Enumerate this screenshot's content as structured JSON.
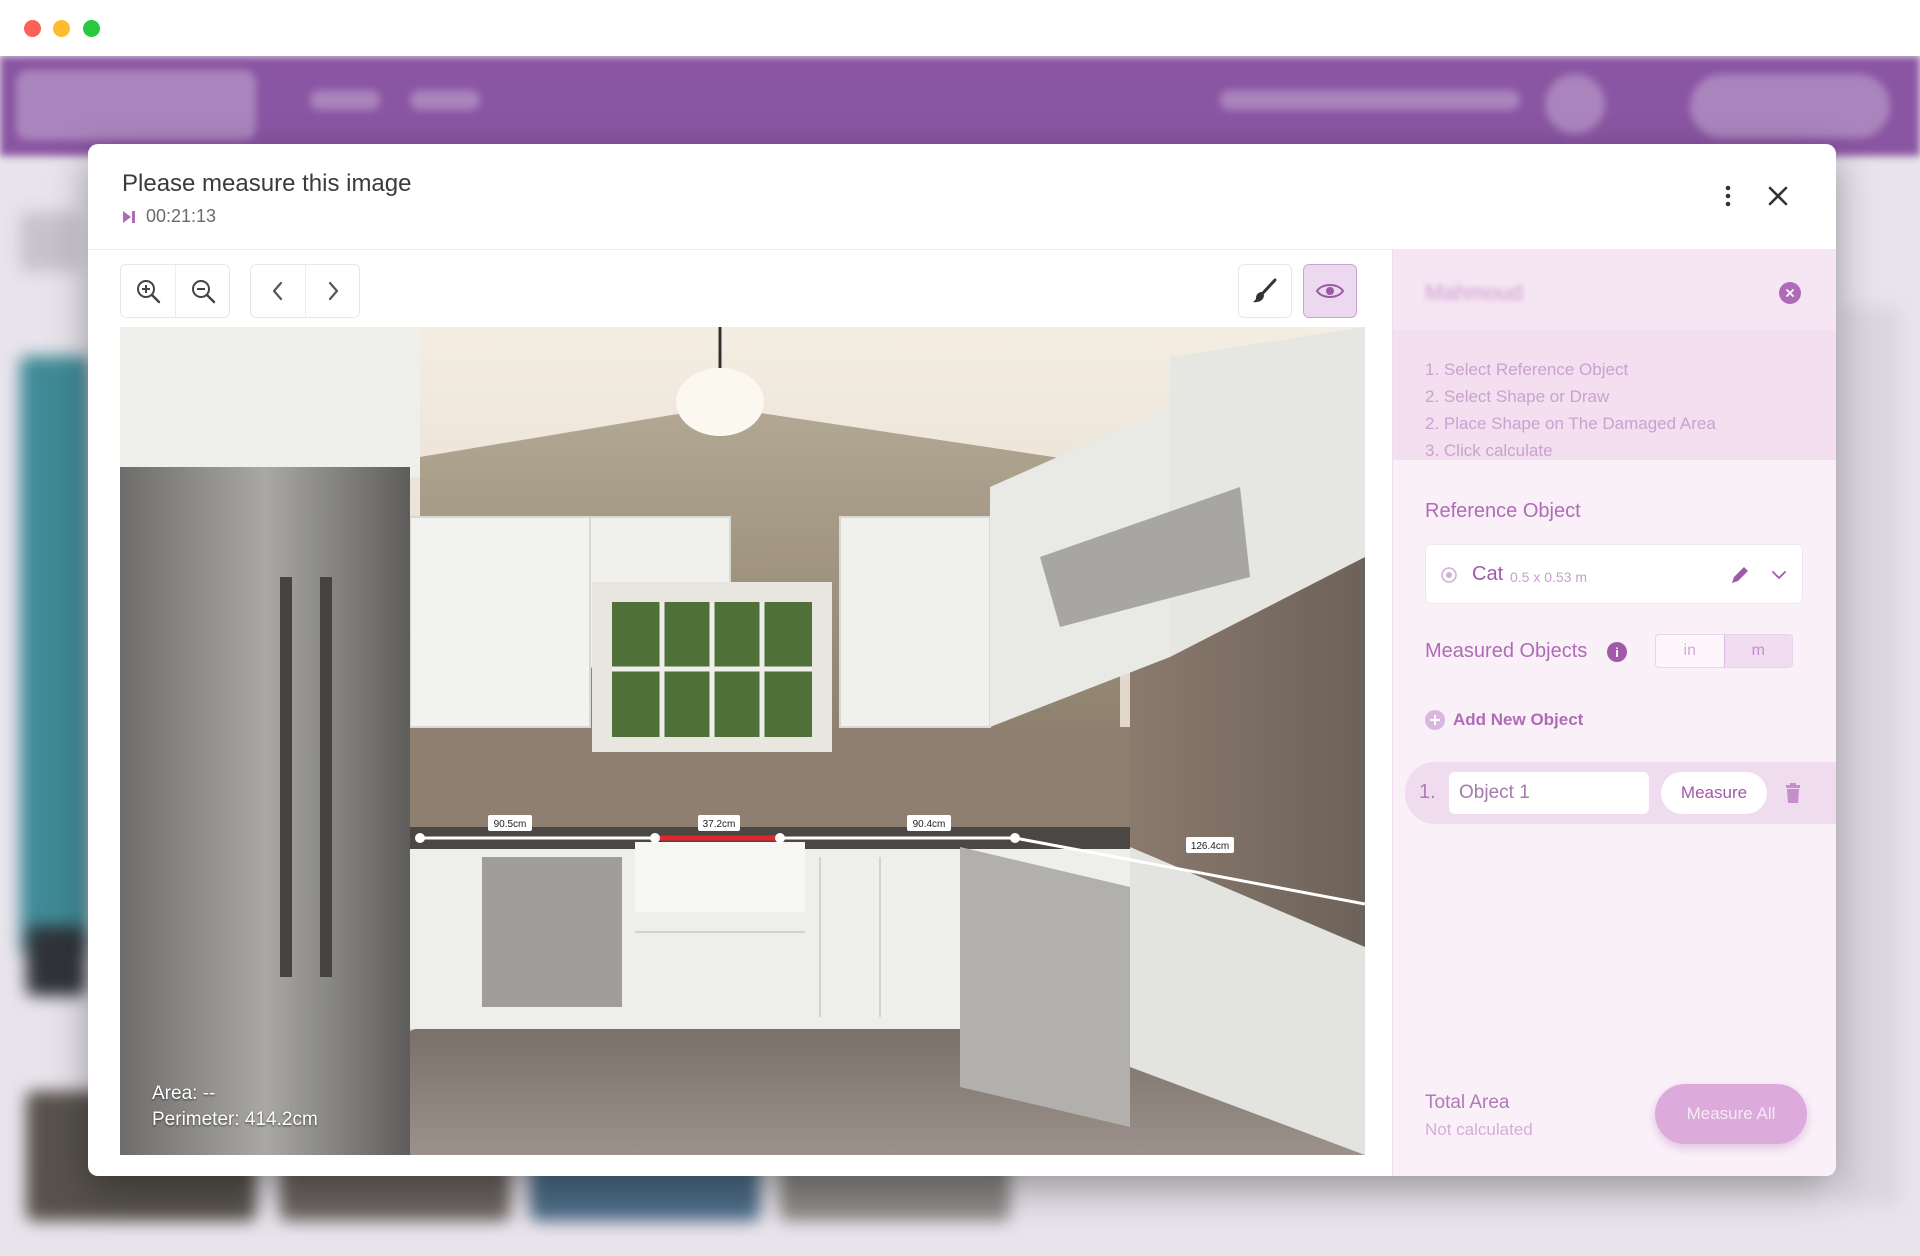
{
  "modal": {
    "title": "Please measure this image",
    "timer": "00:21:13"
  },
  "canvas": {
    "area_text": "Area: --",
    "perimeter_text": "Perimeter: 414.2cm",
    "measurement_labels": [
      "90.5cm",
      "37.2cm",
      "90.4cm",
      "126.4cm"
    ]
  },
  "panel": {
    "title": "Mahmoud",
    "steps": [
      "1. Select Reference Object",
      "2. Select Shape or Draw",
      "2. Place Shape on The Damaged Area",
      "3. Click calculate"
    ],
    "reference_label": "Reference Object",
    "reference_name": "Cat",
    "reference_dims": "0.5 x 0.53 m",
    "measured_label": "Measured Objects",
    "units": [
      "in",
      "m"
    ],
    "selected_unit": "m",
    "add_label": "Add New Object",
    "objects": [
      {
        "num": "1.",
        "name": "Object 1",
        "action": "Measure"
      }
    ],
    "total_label": "Total Area",
    "total_value": "Not calculated",
    "measure_all": "Measure All"
  },
  "colors": {
    "brand": "#8a55a3",
    "accent": "#b06bb8",
    "measure_line": "#ffffff",
    "measure_highlight": "#e2262b"
  }
}
